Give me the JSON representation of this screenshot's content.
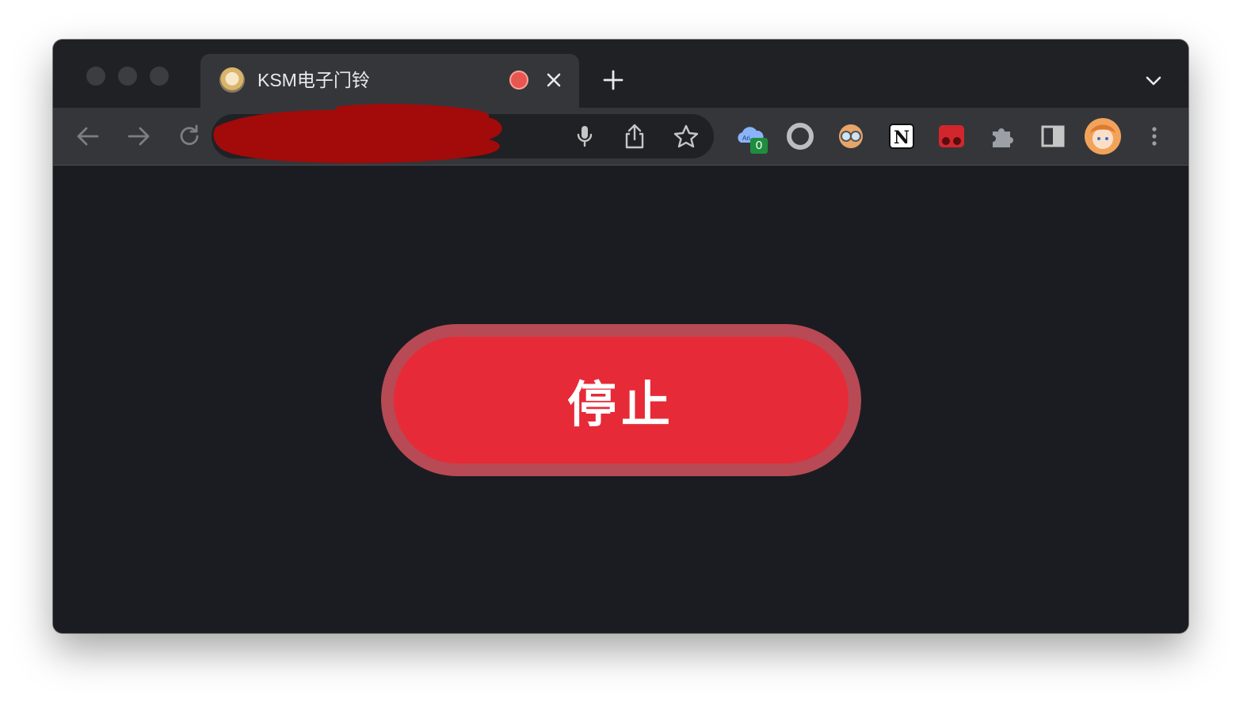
{
  "browser": {
    "tab": {
      "title": "KSM电子门铃"
    },
    "extensions": {
      "cloud_badge_count": "0"
    },
    "colors": {
      "frame": "#202124",
      "toolbar": "#35363a",
      "page_bg": "#1b1c21"
    }
  },
  "page": {
    "stop_button": {
      "label": "停止",
      "color": "#e72a37",
      "ring_color": "#b74a54"
    }
  }
}
